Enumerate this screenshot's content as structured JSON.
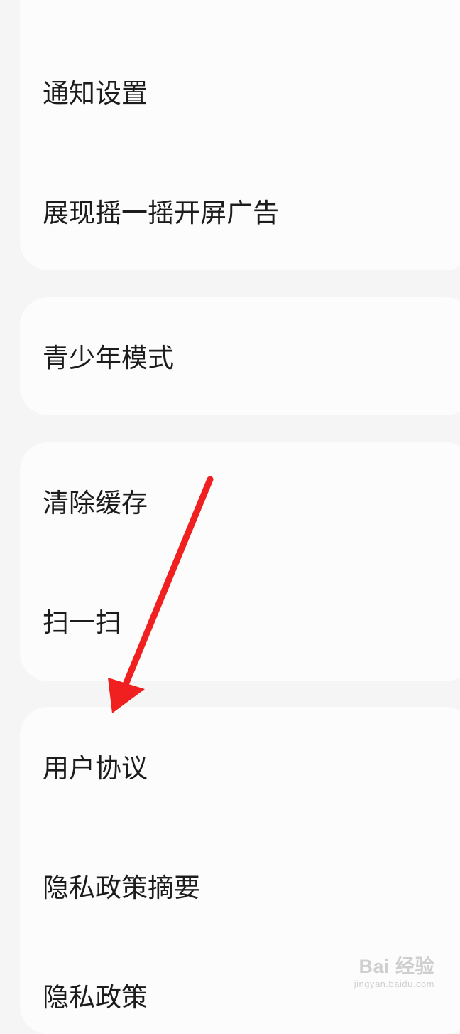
{
  "settings": {
    "group1": {
      "notification_settings": "通知设置",
      "shake_splash_ad": "展现摇一摇开屏广告"
    },
    "group2": {
      "youth_mode": "青少年模式"
    },
    "group3": {
      "clear_cache": "清除缓存",
      "scan": "扫一扫"
    },
    "group4": {
      "user_agreement": "用户协议",
      "privacy_policy_summary": "隐私政策摘要",
      "privacy_policy": "隐私政策"
    }
  },
  "annotation": {
    "arrow_color": "#f02020"
  },
  "watermark": {
    "brand": "Bai 经验",
    "url": "jingyan.baidu.com"
  }
}
